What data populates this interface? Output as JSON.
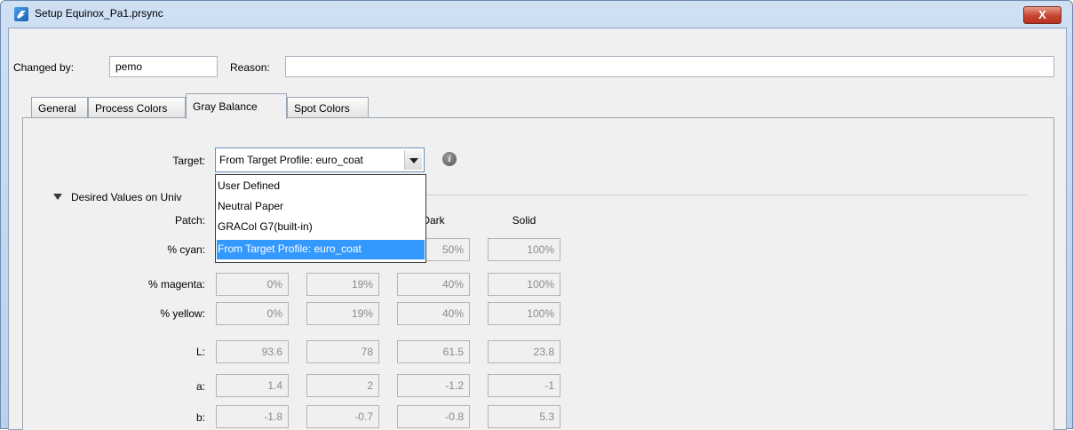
{
  "window": {
    "title": "Setup Equinox_Pa1.prsync",
    "close_label": "X"
  },
  "form": {
    "changed_by_label": "Changed by:",
    "changed_by_value": "pemo",
    "reason_label": "Reason:",
    "reason_value": ""
  },
  "tabs": [
    {
      "label": "General",
      "active": false
    },
    {
      "label": "Process Colors",
      "active": false
    },
    {
      "label": "Gray Balance",
      "active": true
    },
    {
      "label": "Spot Colors",
      "active": false
    }
  ],
  "target": {
    "label": "Target:",
    "selected": "From Target Profile: euro_coat",
    "options": [
      "User Defined",
      "Neutral Paper",
      "GRACol G7(built-in)",
      "From Target Profile: euro_coat"
    ],
    "selected_index": 3
  },
  "section": {
    "title": "Desired Values on Univ"
  },
  "table": {
    "patch_label": "Patch:",
    "columns": [
      "",
      "",
      "Dark",
      "Solid"
    ],
    "rows": [
      {
        "label": "% cyan:",
        "values": [
          "",
          "",
          "50%",
          "100%"
        ]
      },
      {
        "label": "% magenta:",
        "values": [
          "0%",
          "19%",
          "40%",
          "100%"
        ]
      },
      {
        "label": "% yellow:",
        "values": [
          "0%",
          "19%",
          "40%",
          "100%"
        ]
      },
      {
        "label": "L:",
        "values": [
          "93.6",
          "78",
          "61.5",
          "23.8"
        ]
      },
      {
        "label": "a:",
        "values": [
          "1.4",
          "2",
          "-1.2",
          "-1"
        ]
      },
      {
        "label": "b:",
        "values": [
          "-1.8",
          "-0.7",
          "-0.8",
          "5.3"
        ]
      }
    ]
  },
  "colors": {
    "selection": "#3399ff",
    "titlebar": "#c4d8ee",
    "close": "#c7432f"
  },
  "icons": {
    "app": "equinox-app-icon",
    "info": "info-icon",
    "close": "close-icon",
    "dropdown": "chevron-down-icon",
    "collapse": "triangle-down-icon"
  }
}
